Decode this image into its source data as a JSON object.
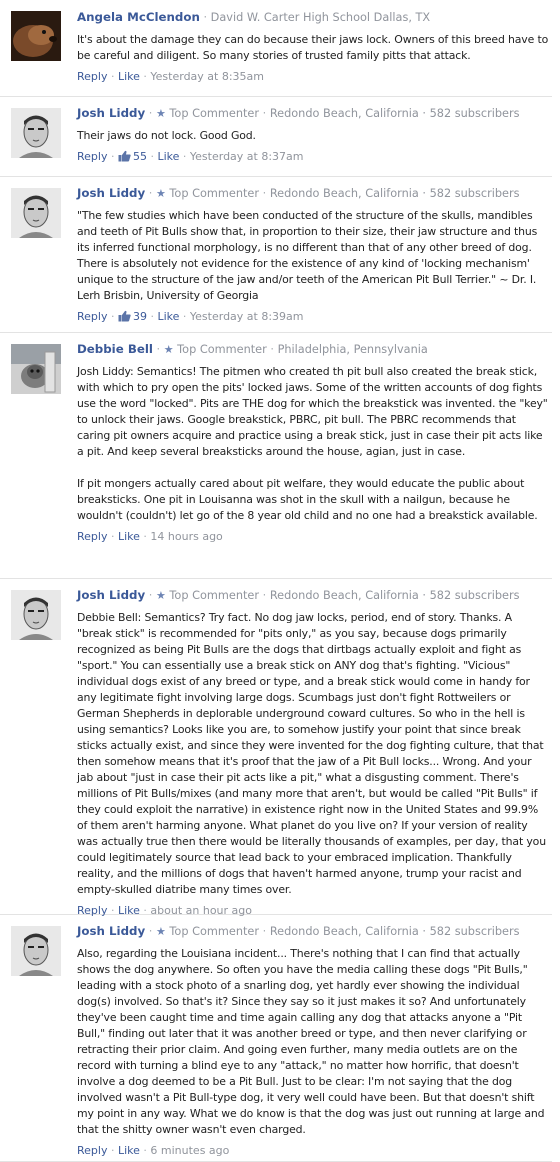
{
  "ui": {
    "separator": "·",
    "reply_label": "Reply",
    "like_label": "Like",
    "top_commenter_label": "Top Commenter"
  },
  "comments": [
    {
      "author": "Angela McClendon",
      "badge": "",
      "detail": "David W. Carter High School Dallas, TX",
      "text": "It's about the damage they can do because their jaws lock. Owners of this breed have to be careful and diligent. So many stories of trusted family pitts that attack.",
      "likes": "",
      "timestamp": "Yesterday at 8:35am",
      "avatar_icon": "dog-avatar"
    },
    {
      "author": "Josh Liddy",
      "badge": "Top Commenter",
      "detail": "Redondo Beach, California · 582 subscribers",
      "text": "Their jaws do not lock. Good God.",
      "likes": "55",
      "timestamp": "Yesterday at 8:37am",
      "avatar_icon": "man-avatar"
    },
    {
      "author": "Josh Liddy",
      "badge": "Top Commenter",
      "detail": "Redondo Beach, California · 582 subscribers",
      "text": "\"The few studies which have been conducted of the structure of the skulls, mandibles and teeth of Pit Bulls show that, in proportion to their size, their jaw structure and thus its inferred functional morphology, is no different than that of any other breed of dog. There is absolutely not evidence for the existence of any kind of 'locking mechanism' unique to the structure of the jaw and/or teeth of the American Pit Bull Terrier.\" ~ Dr. I. Lerh Brisbin, University of Georgia",
      "likes": "39",
      "timestamp": "Yesterday at 8:39am",
      "avatar_icon": "man-avatar"
    },
    {
      "author": "Debbie Bell",
      "badge": "Top Commenter",
      "detail": "Philadelphia, Pennsylvania",
      "text": "Josh Liddy: Semantics! The pitmen who created th pit bull also created the break stick, with which to pry open the pits' locked jaws. Some of the written accounts of dog fights use the word \"locked\". Pits are THE dog for which the breakstick was invented. the \"key\" to unlock their jaws. Google breakstick, PBRC, pit bull. The PBRC recommends that caring pit owners acquire and practice using a break stick, just in case their pit acts like a pit. And keep several breaksticks around the house, agian, just in case.\n\nIf pit mongers actually cared about pit welfare, they would educate the public about breaksticks. One pit in Louisanna was shot in the skull with a nailgun, because he wouldn't (couldn't) let go of the 8 year old child and no one had a breakstick available.",
      "likes": "",
      "timestamp": "14 hours ago",
      "avatar_icon": "dog-avatar"
    },
    {
      "author": "Josh Liddy",
      "badge": "Top Commenter",
      "detail": "Redondo Beach, California · 582 subscribers",
      "text": "Debbie Bell: Semantics? Try fact. No dog jaw locks, period, end of story. Thanks. A \"break stick\" is recommended for \"pits only,\" as you say, because dogs primarily recognized as being Pit Bulls are the dogs that dirtbags actually exploit and fight as \"sport.\" You can essentially use a break stick on ANY dog that's fighting. \"Vicious\" individual dogs exist of any breed or type, and a break stick would come in handy for any legitimate fight involving large dogs. Scumbags just don't fight Rottweilers or German Shepherds in deplorable underground coward cultures. So who in the hell is using semantics? Looks like you are, to somehow justify your point that since break sticks actually exist, and since they were invented for the dog fighting culture, that that then somehow means that it's proof that the jaw of a Pit Bull locks... Wrong. And your jab about \"just in case their pit acts like a pit,\" what a disgusting comment. There's millions of Pit Bulls/mixes (and many more that aren't, but would be called \"Pit Bulls\" if they could exploit the narrative) in existence right now in the United States and 99.9% of them aren't harming anyone. What planet do you live on? If your version of reality was actually true then there would be literally thousands of examples, per day, that you could legitimately source that lead back to your embraced implication. Thankfully reality, and the millions of dogs that haven't harmed anyone, trump your racist and empty-skulled diatribe many times over.",
      "likes": "",
      "timestamp": "about an hour ago",
      "avatar_icon": "man-avatar"
    },
    {
      "author": "Josh Liddy",
      "badge": "Top Commenter",
      "detail": "Redondo Beach, California · 582 subscribers",
      "text": "Also, regarding the Louisiana incident... There's nothing that I can find that actually shows the dog anywhere. So often you have the media calling these dogs \"Pit Bulls,\" leading with a stock photo of a snarling dog, yet hardly ever showing the individual dog(s) involved. So that's it? Since they say so it just makes it so? And unfortunately they've been caught time and time again calling any dog that attacks anyone a \"Pit Bull,\" finding out later that it was another breed or type, and then never clarifying or retracting their prior claim. And going even further, many media outlets are on the record with turning a blind eye to any \"attack,\" no matter how horrific, that doesn't involve a dog deemed to be a Pit Bull. Just to be clear: I'm not saying that the dog involved wasn't a Pit Bull-type dog, it very well could have been. But that doesn't shift my point in any way. What we do know is that the dog was just out running at large and that the shitty owner wasn't even charged.",
      "likes": "",
      "timestamp": "6 minutes ago",
      "avatar_icon": "man-avatar"
    }
  ]
}
